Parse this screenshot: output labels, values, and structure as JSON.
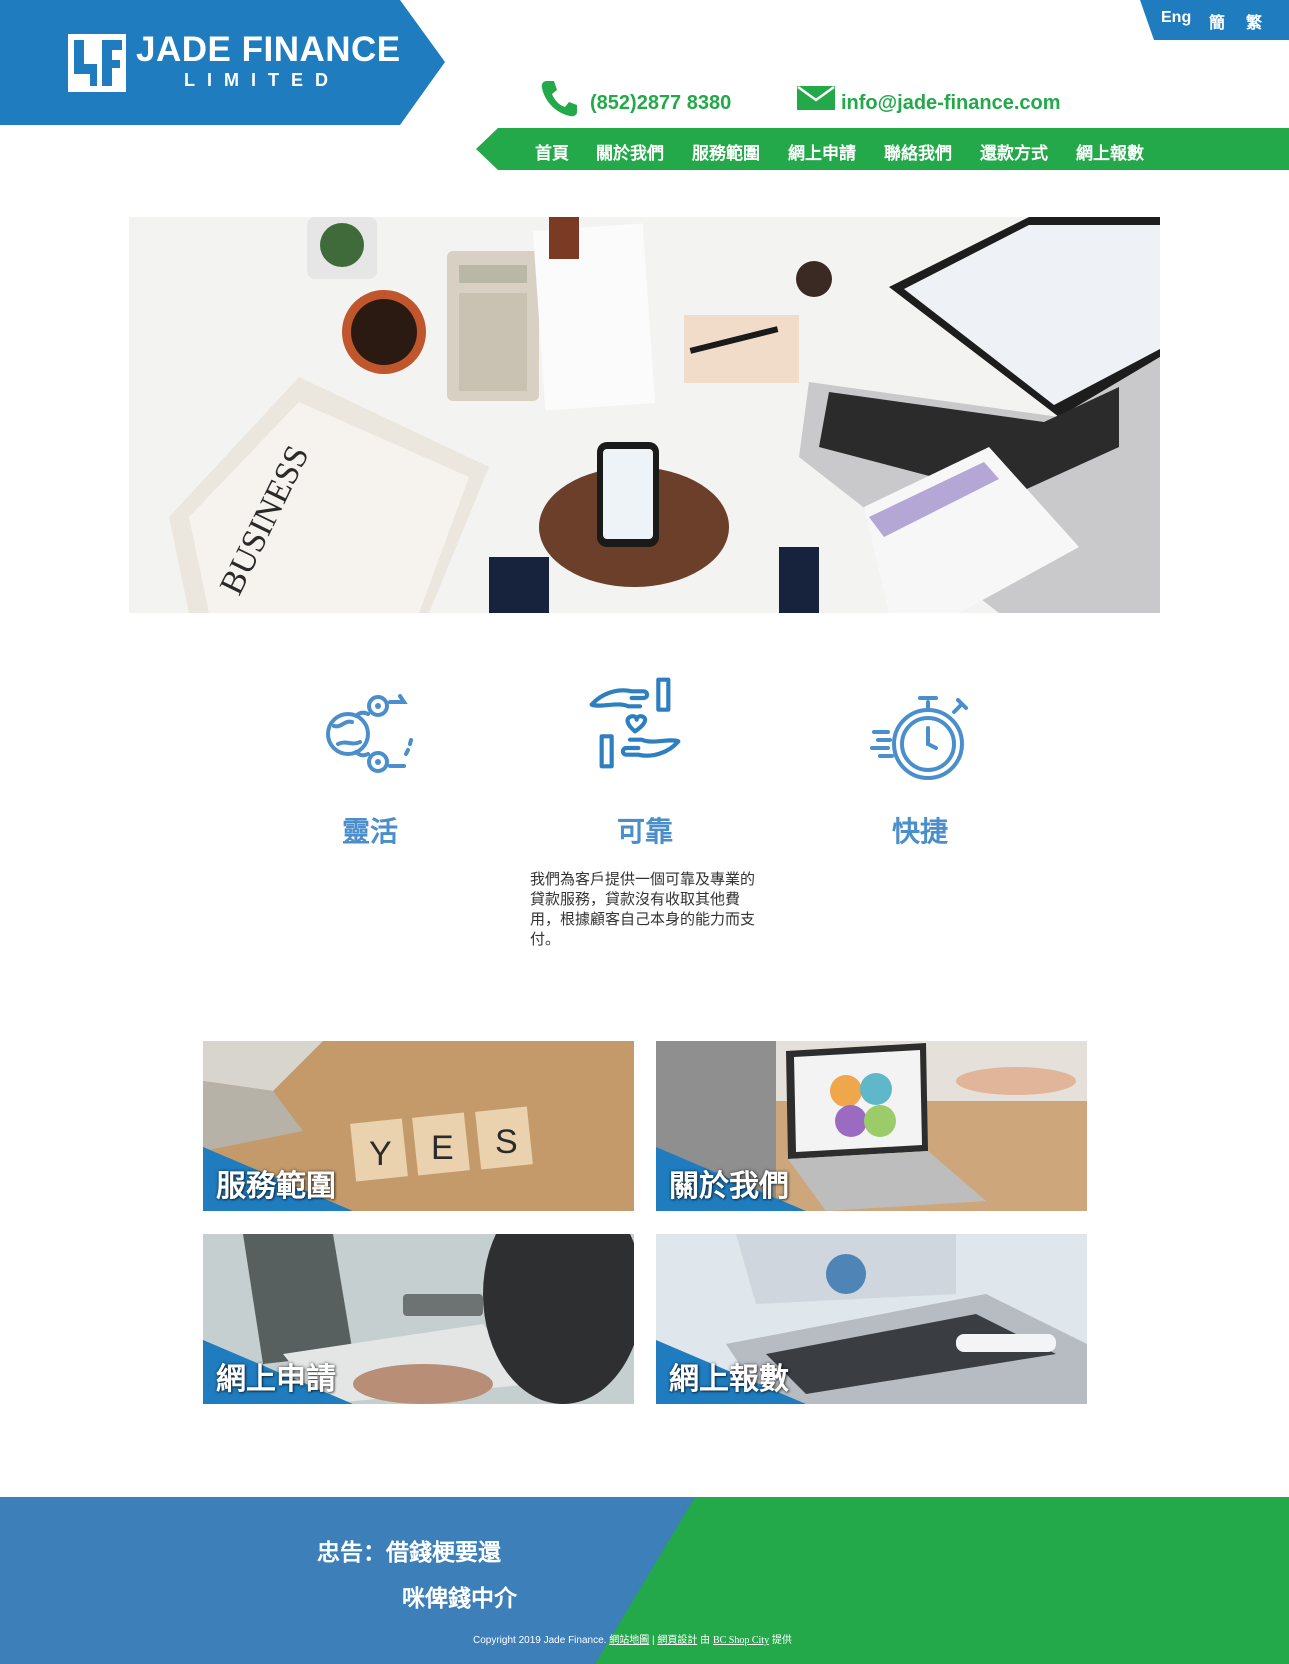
{
  "brand": {
    "name": "JADE FINANCE",
    "sub": "LIMITED",
    "primary_color": "#1f7cbf",
    "accent_color": "#23a84a"
  },
  "lang": [
    "Eng",
    "簡",
    "繁"
  ],
  "contact": {
    "phone": "(852)2877 8380",
    "email": "info@jade-finance.com"
  },
  "nav": [
    "首頁",
    "關於我們",
    "服務範圍",
    "網上申請",
    "聯絡我們",
    "還款方式",
    "網上報數"
  ],
  "hero": {
    "icon": "hero-photo-finance-desk"
  },
  "features": {
    "flexible": "靈活",
    "reliable": "可靠",
    "fast": "快捷",
    "reliable_desc": "我們為客戶提供一個可靠及專業的貸款服務，貸款沒有收取其他費用，根據顧客自己本身的能力而支付。"
  },
  "tiles": [
    "服務範圍",
    "關於我們",
    "網上申請",
    "網上報數"
  ],
  "footer": {
    "warning1": "忠告：借錢梗要還",
    "warning2": "咪俾錢中介",
    "copyright_prefix": "Copyright 2019 Jade Finance.",
    "sitemap": "網站地圖",
    "separator": "|",
    "design": "網頁設計",
    "by": "由",
    "provider": "BC Shop City",
    "suffix": "提供"
  }
}
